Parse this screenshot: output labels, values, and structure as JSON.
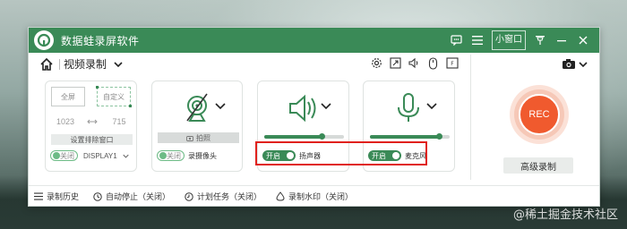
{
  "app": {
    "title": "数据蛙录屏软件",
    "mini_window_label": "小窗口"
  },
  "toolbar": {
    "mode_label": "视频录制"
  },
  "screen_panel": {
    "fullscreen_label": "全屏",
    "custom_label": "自定义",
    "width_value": "1023",
    "height_value": "715",
    "exclude_button_label": "设置排除窗口",
    "toggle_label": "关闭",
    "display_label": "DISPLAY1"
  },
  "camera_panel": {
    "photo_label": "拍照",
    "toggle_label": "关闭",
    "name_label": "录摄像头"
  },
  "speaker_panel": {
    "toggle_label": "开启",
    "name_label": "扬声器",
    "volume": 0.72
  },
  "mic_panel": {
    "toggle_label": "开启",
    "name_label": "麦克风",
    "volume": 0.86
  },
  "rec": {
    "button_label": "REC",
    "advanced_label": "高级录制"
  },
  "bottom_bar": {
    "history_label": "录制历史",
    "auto_stop_label": "自动停止（关闭）",
    "schedule_label": "计划任务（关闭）",
    "watermark_label": "录制水印（关闭）"
  },
  "desktop": {
    "watermark_text": "@稀土掘金技术社区"
  },
  "colors": {
    "brand_green": "#3a8a57",
    "rec_orange": "#f05a2e",
    "highlight_red": "#e0211d"
  }
}
